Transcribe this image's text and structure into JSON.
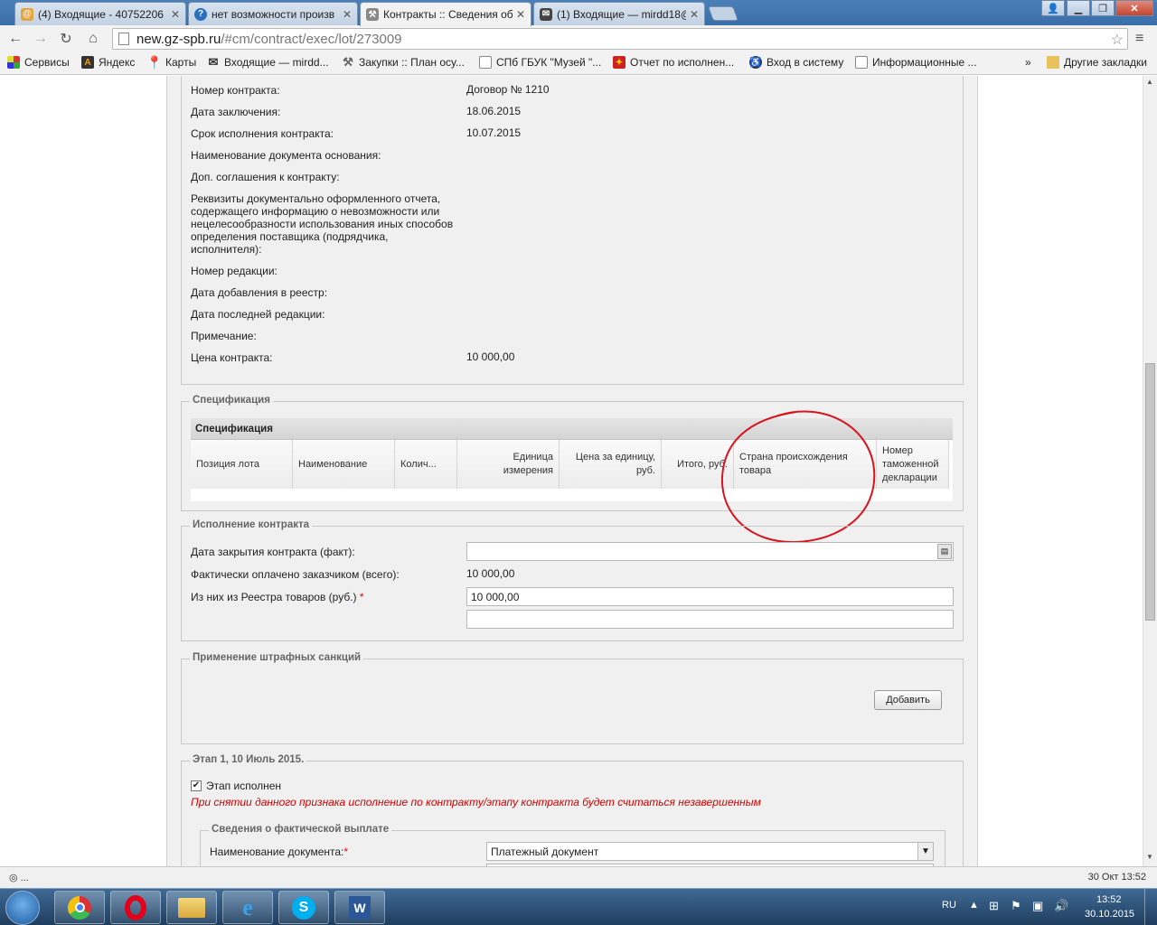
{
  "browser": {
    "tabs": [
      {
        "title": "(4) Входящие - 40752206",
        "icon": "mail-icon",
        "active": false
      },
      {
        "title": "нет возможности произв",
        "icon": "help-icon",
        "active": false
      },
      {
        "title": "Контракты :: Сведения об",
        "icon": "gavel-icon",
        "active": true
      },
      {
        "title": "(1) Входящие — mirdd18@",
        "icon": "mail-icon",
        "active": false
      }
    ],
    "url_host": "new.gz-spb.ru",
    "url_path": "/#cm/contract/exec/lot/273009",
    "bookmarks": [
      {
        "label": "Сервисы",
        "icon": "apps-icon"
      },
      {
        "label": "Яндекс",
        "icon": "yandex-icon"
      },
      {
        "label": "Карты",
        "icon": "map-pin-icon"
      },
      {
        "label": "Входящие — mirdd...",
        "icon": "mail-icon"
      },
      {
        "label": "Закупки :: План осу...",
        "icon": "gavel-icon"
      },
      {
        "label": "СПб ГБУК \"Музей \"...",
        "icon": "page-icon"
      },
      {
        "label": "Отчет по исполнен...",
        "icon": "emblem-icon"
      },
      {
        "label": "Вход в систему",
        "icon": "accessibility-icon"
      },
      {
        "label": "Информационные ...",
        "icon": "page-icon"
      }
    ],
    "bookmarks_overflow": "»",
    "other_bookmarks": "Другие закладки",
    "status_text": "◎ ..."
  },
  "contract_info": {
    "rows": [
      {
        "label": "Номер контракта:",
        "value": "Договор № 1210"
      },
      {
        "label": "Дата заключения:",
        "value": "18.06.2015"
      },
      {
        "label": "Срок исполнения контракта:",
        "value": "10.07.2015"
      },
      {
        "label": "Наименование документа основания:",
        "value": ""
      },
      {
        "label": "Доп. соглашения к контракту:",
        "value": ""
      }
    ],
    "requisites_label": "Реквизиты документально оформленного отчета, содержащего информацию о невозможности или нецелесообразности использования иных способов определения поставщика (подрядчика, исполнителя):",
    "rows2": [
      {
        "label": "Номер редакции:",
        "value": ""
      },
      {
        "label": "Дата добавления в реестр:",
        "value": ""
      },
      {
        "label": "Дата последней редакции:",
        "value": ""
      },
      {
        "label": "Примечание:",
        "value": ""
      },
      {
        "label": "Цена контракта:",
        "value": "10 000,00"
      }
    ]
  },
  "specification": {
    "legend": "Спецификация",
    "grid_title": "Спецификация",
    "columns": [
      "Позиция лота",
      "Наименование",
      "Колич...",
      "Единица измерения",
      "Цена за единицу, руб.",
      "Итого, руб.",
      "Страна происхождения товара",
      "Номер таможенной декларации"
    ]
  },
  "execution": {
    "legend": "Исполнение контракта",
    "close_date_label": "Дата закрытия контракта (факт):",
    "close_date_value": "",
    "paid_label": "Фактически оплачено заказчиком (всего):",
    "paid_value": "10 000,00",
    "registry_label": "Из них из Реестра товаров (руб.)",
    "registry_required": "*",
    "registry_value": "10 000,00",
    "extra_value": ""
  },
  "penalties": {
    "legend": "Применение штрафных санкций",
    "add_button": "Добавить"
  },
  "stage": {
    "legend": "Этап 1, 10 Июль 2015.",
    "checkbox_label": "Этап исполнен",
    "checkbox_checked": true,
    "warning": "При снятии данного признака исполнение по контракту/этапу контракта будет считаться незавершенным",
    "payment_legend": "Сведения о фактической выплате",
    "doc_label": "Наименование документа:",
    "doc_required": "*",
    "doc_value": "Платежный документ"
  },
  "taskbar": {
    "apps": [
      "start-orb-icon",
      "chrome-icon",
      "opera-icon",
      "explorer-icon",
      "ie-icon",
      "skype-icon",
      "word-icon"
    ],
    "lang": "RU",
    "time": "13:52",
    "date": "30.10.2015",
    "status_right": "30 Окт 13:52"
  },
  "colors": {
    "annotation_circle": "#d8141c",
    "required": "#e00000",
    "warning": "#d00000"
  }
}
